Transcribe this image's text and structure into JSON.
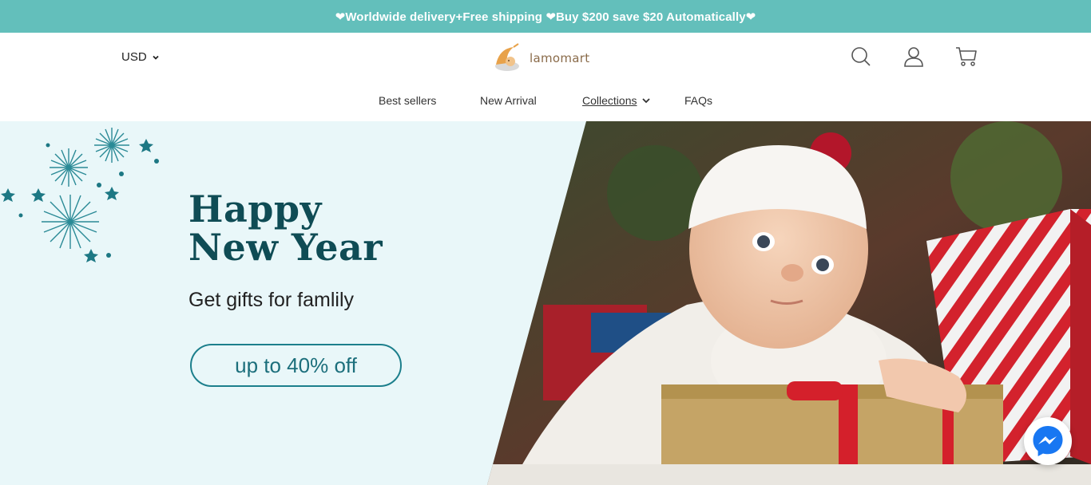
{
  "announcement": {
    "text": "❤Worldwide delivery+Free shipping ❤Buy $200 save $20 Automatically❤"
  },
  "header": {
    "currency": "USD",
    "brand": "lamomart",
    "icons": [
      "search-icon",
      "account-icon",
      "cart-icon"
    ]
  },
  "nav": {
    "items": [
      {
        "label": "Best sellers"
      },
      {
        "label": "New Arrival"
      },
      {
        "label": "Collections"
      },
      {
        "label": "FAQs"
      }
    ]
  },
  "hero": {
    "title_line1": "Happy",
    "title_line2": "New Year",
    "subtitle": "Get gifts for famlily",
    "button_label": "up to 40% off"
  },
  "colors": {
    "announce_bg": "#63bfbb",
    "hero_bg": "#e9f7f9",
    "title": "#0f4c55",
    "accent": "#1c7f8c",
    "messenger": "#1877f2"
  }
}
